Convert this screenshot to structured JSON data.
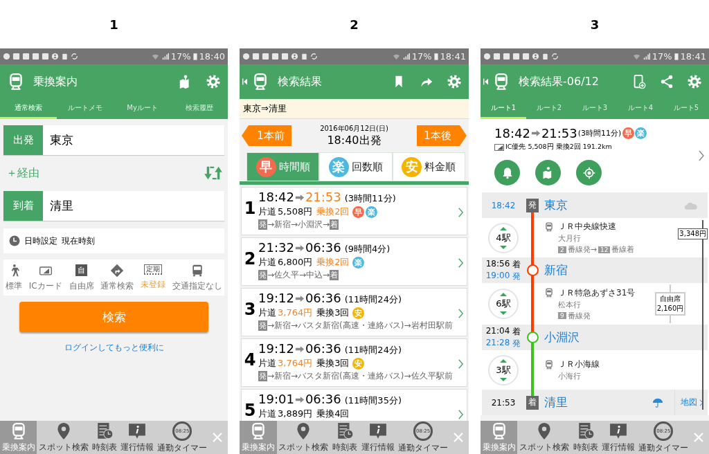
{
  "screens": [
    {
      "number": "1",
      "kind": "search",
      "status_bar": {
        "battery": "17%",
        "time": "18:40"
      },
      "header": {
        "title": "乗換案内",
        "back": false
      },
      "tabs": [
        {
          "label": "通常検索",
          "selected": true
        },
        {
          "label": "ルートメモ",
          "selected": false
        },
        {
          "label": "Myルート",
          "selected": false
        },
        {
          "label": "検索履歴",
          "selected": false
        }
      ],
      "from": {
        "label": "出発",
        "value": "東京"
      },
      "via": "＋経由",
      "to": {
        "label": "到着",
        "value": "清里"
      },
      "datetime": {
        "label": "日時設定",
        "value": "現在時刻"
      },
      "options": [
        {
          "label": "標準",
          "highlight": false
        },
        {
          "label": "ICカード",
          "highlight": false
        },
        {
          "label": "自由席",
          "icon_text": "自",
          "highlight": false
        },
        {
          "label": "通常検索",
          "highlight": false
        },
        {
          "label": "未登録",
          "icon_text": "定期",
          "highlight": true
        },
        {
          "label": "交通指定なし",
          "highlight": false
        }
      ],
      "search_button": "検索",
      "login_link": "ログインしてもっと便利に",
      "nav": [
        {
          "label": "乗換案内",
          "selected": true
        },
        {
          "label": "スポット検索",
          "selected": false
        },
        {
          "label": "時刻表",
          "selected": false
        },
        {
          "label": "運行情報",
          "selected": false
        },
        {
          "label": "通勤タイマー",
          "icon_text": "08:25",
          "selected": false
        }
      ]
    },
    {
      "number": "2",
      "kind": "results",
      "status_bar": {
        "battery": "17%",
        "time": "18:41"
      },
      "header": {
        "title": "検索結果",
        "back": true
      },
      "route": "東京⇒清里",
      "prev": "1本前",
      "next": "1本後",
      "date": "2016年06月12日(日)",
      "departure": "18:40出発",
      "sort_tabs": [
        {
          "badge": "早",
          "label": "時間順",
          "color": "#f26b4e",
          "selected": true
        },
        {
          "badge": "楽",
          "label": "回数順",
          "color": "#4db8e0",
          "selected": false
        },
        {
          "badge": "安",
          "label": "料金順",
          "color": "#f5b400",
          "selected": false
        }
      ],
      "results": [
        {
          "number": "1",
          "dep": "18:42",
          "arr": "21:53",
          "arr_highlight": true,
          "duration": "(3時間11分)",
          "fare_label": "片道",
          "fare": "5,508円",
          "fare_highlight": false,
          "transfers": "乗換2回",
          "transfers_highlight": true,
          "badges": [
            {
              "text": "早",
              "color": "#f26b4e"
            },
            {
              "text": "楽",
              "color": "#4db8e0"
            }
          ],
          "route": [
            {
              "kind": "mark",
              "text": "発"
            },
            {
              "kind": "text",
              "text": "→新宿→小淵沢→"
            },
            {
              "kind": "mark",
              "text": "着"
            }
          ]
        },
        {
          "number": "2",
          "dep": "21:32",
          "arr": "06:36",
          "arr_highlight": false,
          "duration": "(9時間4分)",
          "fare_label": "片道",
          "fare": "6,800円",
          "fare_highlight": false,
          "transfers": "乗換2回",
          "transfers_highlight": true,
          "badges": [
            {
              "text": "楽",
              "color": "#4db8e0"
            }
          ],
          "route": [
            {
              "kind": "mark",
              "text": "発"
            },
            {
              "kind": "text",
              "text": "→佐久平→中込→"
            },
            {
              "kind": "mark",
              "text": "着"
            }
          ]
        },
        {
          "number": "3",
          "dep": "19:12",
          "arr": "06:36",
          "arr_highlight": false,
          "duration": "(11時間24分)",
          "fare_label": "片道",
          "fare": "3,764円",
          "fare_highlight": true,
          "transfers": "乗換3回",
          "transfers_highlight": false,
          "badges": [
            {
              "text": "安",
              "color": "#f5b400"
            }
          ],
          "route": [
            {
              "kind": "mark",
              "text": "発"
            },
            {
              "kind": "text",
              "text": "→新宿→バスタ新宿(高速・連絡バス)→岩村田駅前"
            }
          ]
        },
        {
          "number": "4",
          "dep": "19:12",
          "arr": "06:36",
          "arr_highlight": false,
          "duration": "(11時間24分)",
          "fare_label": "片道",
          "fare": "3,764円",
          "fare_highlight": true,
          "transfers": "乗換3回",
          "transfers_highlight": false,
          "badges": [
            {
              "text": "安",
              "color": "#f5b400"
            }
          ],
          "route": [
            {
              "kind": "mark",
              "text": "発"
            },
            {
              "kind": "text",
              "text": "→新宿→バスタ新宿(高速・連絡バス)→佐久平駅前"
            }
          ]
        },
        {
          "number": "5",
          "dep": "19:01",
          "arr": "06:36",
          "arr_highlight": false,
          "duration": "(11時間35分)",
          "fare_label": "片道",
          "fare": "3,889円",
          "fare_highlight": false,
          "transfers": "乗換4回",
          "transfers_highlight": false
        }
      ],
      "nav": [
        {
          "label": "乗換案内",
          "selected": true
        },
        {
          "label": "スポット検索",
          "selected": false
        },
        {
          "label": "時刻表",
          "selected": false
        },
        {
          "label": "運行情報",
          "selected": false
        },
        {
          "label": "通勤タイマー",
          "icon_text": "08:25",
          "selected": false
        }
      ]
    },
    {
      "number": "3",
      "kind": "detail",
      "status_bar": {
        "battery": "17%",
        "time": "18:41"
      },
      "header": {
        "title": "検索結果-06/12",
        "back": true
      },
      "tabs": [
        {
          "label": "ルート1",
          "selected": true
        },
        {
          "label": "ルート2",
          "selected": false
        },
        {
          "label": "ルート3",
          "selected": false
        },
        {
          "label": "ルート4",
          "selected": false
        },
        {
          "label": "ルート5",
          "selected": false
        }
      ],
      "summary": {
        "dep": "18:42",
        "arr": "21:53",
        "duration": "(3時間11分)",
        "badges": [
          {
            "text": "早",
            "color": "#f26b4e"
          },
          {
            "text": "楽",
            "color": "#4db8e0"
          }
        ],
        "info": "IC優先 5,508円 乗換2回 191.2km"
      },
      "total_fare": "3,348円",
      "timeline": [
        {
          "kind": "start",
          "time": "18:42",
          "mark": "発",
          "name": "東京"
        },
        {
          "kind": "ride",
          "count": "4駅",
          "line": "ＪＲ中央線快速",
          "destination": "大月行",
          "color": "#ff3b00",
          "platforms": [
            {
              "number": "2",
              "text": "番線発→"
            },
            {
              "number": "12",
              "text": "番線着"
            }
          ]
        },
        {
          "kind": "transfer",
          "arrival": "18:56",
          "arrival_label": "着",
          "departure": "19:00",
          "departure_label": "発",
          "name": "新宿"
        },
        {
          "kind": "ride",
          "count": "6駅",
          "line": "ＪＲ特急あずさ31号",
          "destination": "松本行",
          "color": "#ff3b00",
          "platforms": [
            {
              "number": "9",
              "text": "番線発"
            }
          ],
          "fare_label": "自由席",
          "fare": "2,160円"
        },
        {
          "kind": "transfer",
          "arrival": "21:04",
          "arrival_label": "着",
          "departure": "21:28",
          "departure_label": "発",
          "name": "小淵沢"
        },
        {
          "kind": "ride",
          "count": "3駅",
          "line": "ＪＲ小海線",
          "destination": "小海行",
          "color": "#3cc21a"
        },
        {
          "kind": "end",
          "time": "21:53",
          "mark": "着",
          "name": "清里",
          "map_link": "地図"
        }
      ],
      "nav": [
        {
          "label": "乗換案内",
          "selected": true
        },
        {
          "label": "スポット検索",
          "selected": false
        },
        {
          "label": "時刻表",
          "selected": false
        },
        {
          "label": "運行情報",
          "selected": false
        },
        {
          "label": "通勤タイマー",
          "icon_text": "08:25",
          "selected": false
        }
      ]
    }
  ]
}
